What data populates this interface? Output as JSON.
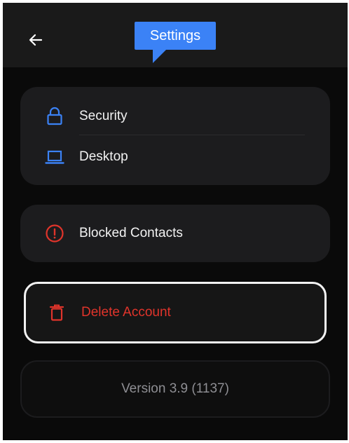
{
  "header": {
    "title": "Settings",
    "back_icon": "arrow-left-icon"
  },
  "menu": {
    "items": [
      {
        "label": "Security",
        "icon": "lock-icon"
      },
      {
        "label": "Desktop",
        "icon": "laptop-icon"
      }
    ]
  },
  "blocked": {
    "label": "Blocked Contacts",
    "icon": "alert-circle-icon"
  },
  "delete_account": {
    "label": "Delete Account",
    "icon": "trash-icon"
  },
  "footer": {
    "version": "Version 3.9 (1137)"
  },
  "colors": {
    "accent": "#3b82f6",
    "danger": "#e0342b",
    "background": "#0a0a0a",
    "card": "#1c1c1e",
    "text": "#f2f2f2",
    "muted": "#8e8e93"
  }
}
